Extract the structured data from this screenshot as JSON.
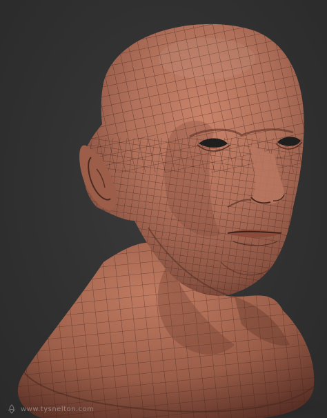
{
  "image": {
    "subject": "3D sculpted head and neck mesh with wireframe topology",
    "background_color": "#333333",
    "skin_color": "#b0705a",
    "wire_color": "#3a2018"
  },
  "watermark": {
    "text": "www.tysnelton.com",
    "logo_icon": "celtic-knot-icon"
  }
}
